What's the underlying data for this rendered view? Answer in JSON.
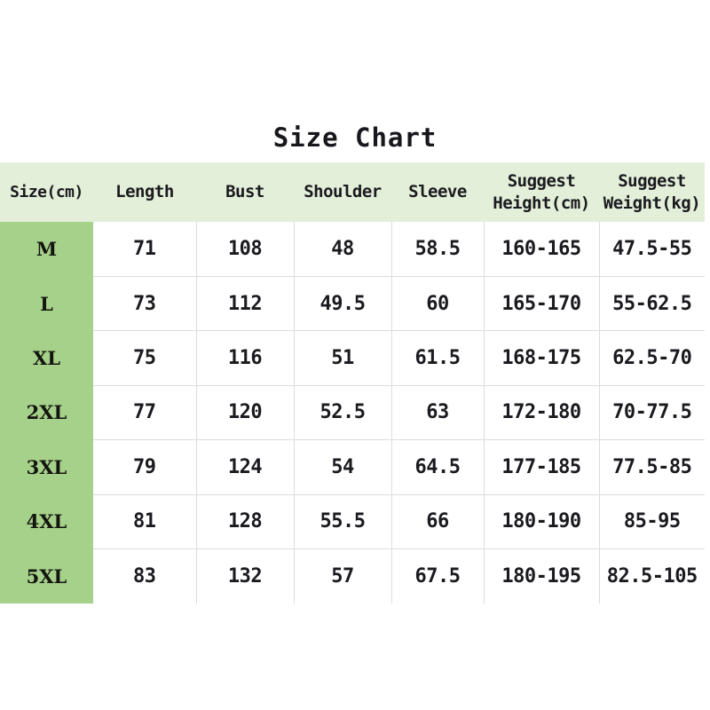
{
  "title": "Size Chart",
  "table": {
    "headers": [
      {
        "id": "size",
        "lines": [
          "Size(cm)"
        ]
      },
      {
        "id": "length",
        "lines": [
          "Length"
        ]
      },
      {
        "id": "bust",
        "lines": [
          "Bust"
        ]
      },
      {
        "id": "shoulder",
        "lines": [
          "Shoulder"
        ]
      },
      {
        "id": "sleeve",
        "lines": [
          "Sleeve"
        ]
      },
      {
        "id": "height",
        "lines": [
          "Suggest",
          "Height(cm)"
        ]
      },
      {
        "id": "weight",
        "lines": [
          "Suggest",
          "Weight(kg)"
        ]
      }
    ],
    "rows": [
      {
        "size": "M",
        "length": "71",
        "bust": "108",
        "shoulder": "48",
        "sleeve": "58.5",
        "height": "160-165",
        "weight": "47.5-55"
      },
      {
        "size": "L",
        "length": "73",
        "bust": "112",
        "shoulder": "49.5",
        "sleeve": "60",
        "height": "165-170",
        "weight": "55-62.5"
      },
      {
        "size": "XL",
        "length": "75",
        "bust": "116",
        "shoulder": "51",
        "sleeve": "61.5",
        "height": "168-175",
        "weight": "62.5-70"
      },
      {
        "size": "2XL",
        "length": "77",
        "bust": "120",
        "shoulder": "52.5",
        "sleeve": "63",
        "height": "172-180",
        "weight": "70-77.5"
      },
      {
        "size": "3XL",
        "length": "79",
        "bust": "124",
        "shoulder": "54",
        "sleeve": "64.5",
        "height": "177-185",
        "weight": "77.5-85"
      },
      {
        "size": "4XL",
        "length": "81",
        "bust": "128",
        "shoulder": "55.5",
        "sleeve": "66",
        "height": "180-190",
        "weight": "85-95"
      },
      {
        "size": "5XL",
        "length": "83",
        "bust": "132",
        "shoulder": "57",
        "sleeve": "67.5",
        "height": "180-195",
        "weight": "82.5-105"
      }
    ]
  },
  "colors": {
    "header_band": "#e3efd9",
    "size_column": "#a5d18a",
    "grid_line": "#dcdcdc",
    "text": "#1a1a1f",
    "background": "#ffffff"
  }
}
